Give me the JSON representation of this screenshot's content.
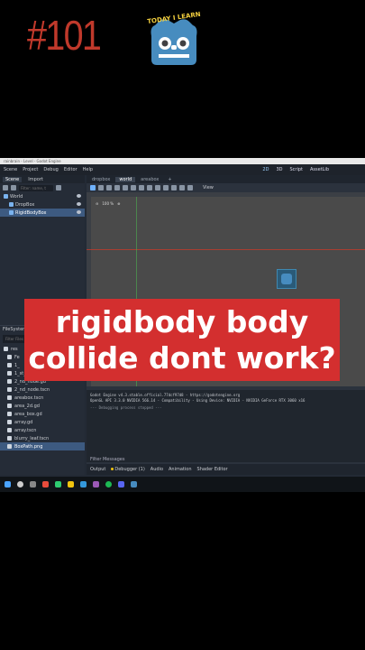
{
  "overlay": {
    "episode": "#101",
    "logo_text": "TODAY I LEARN",
    "banner_line1": "rigidbody body",
    "banner_line2": "collide dont work?"
  },
  "window": {
    "title": "rainbrain - Level - Godot Engine",
    "menu": [
      "Scene",
      "Project",
      "Debug",
      "Editor",
      "Help"
    ],
    "workspaces": [
      "2D",
      "3D",
      "Script",
      "AssetLib"
    ],
    "active_workspace": "2D"
  },
  "scene_dock": {
    "tabs": [
      "Scene",
      "Import"
    ],
    "filter_placeholder": "Filter: name, t",
    "nodes": [
      {
        "label": "World"
      },
      {
        "label": "DropBox"
      },
      {
        "label": "RigidBodyBox"
      }
    ]
  },
  "filesystem": {
    "header": "FileSystem",
    "path": "res",
    "search_placeholder": "Filter Files",
    "items": [
      "res",
      "Fe",
      "1_",
      "1_st_node.tscn",
      "2_nd_node.gd",
      "2_nd_node.tscn",
      "areabox.tscn",
      "area_2d.gd",
      "area_box.gd",
      "array.gd",
      "array.tscn",
      "blurry_leaf.tscn",
      "BoxPath.png"
    ]
  },
  "editor": {
    "tabs": [
      "dropbox",
      "world",
      "areabox"
    ],
    "active_tab": "world",
    "zoom": "100 %",
    "view_label": "View"
  },
  "output": {
    "line1": "Godot Engine v4.3.stable.official.77dcf97d8 - https://godotengine.org",
    "line2": "OpenGL API 3.3.0 NVIDIA 566.14 - Compatibility - Using Device: NVIDIA - NVIDIA GeForce RTX 3060 x16",
    "line3": "--- Debugging process stopped ---"
  },
  "bottom_panel": {
    "filter": "Filter Messages",
    "tabs": [
      "Output",
      "Debugger (1)",
      "Audio",
      "Animation",
      "Shader Editor"
    ]
  },
  "colors": {
    "banner": "#d32f2f",
    "episode": "#c0392b",
    "godot_blue": "#478cbf"
  }
}
